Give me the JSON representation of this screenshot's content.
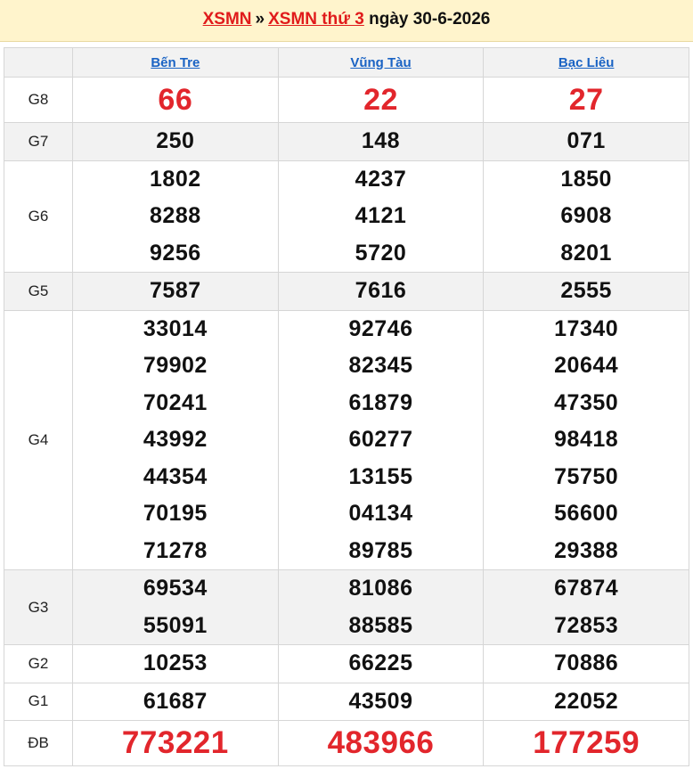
{
  "header": {
    "crumb1": "XSMN",
    "separator": "»",
    "crumb2": "XSMN thứ 3",
    "date_text": "ngày 30-6-2026"
  },
  "provinces": [
    "Bến Tre",
    "Vũng Tàu",
    "Bạc Liêu"
  ],
  "prizes": [
    {
      "label": "G8",
      "key": "g8",
      "shade": false,
      "values": [
        [
          "66"
        ],
        [
          "22"
        ],
        [
          "27"
        ]
      ]
    },
    {
      "label": "G7",
      "key": "g7",
      "shade": true,
      "values": [
        [
          "250"
        ],
        [
          "148"
        ],
        [
          "071"
        ]
      ]
    },
    {
      "label": "G6",
      "key": "g6",
      "shade": false,
      "values": [
        [
          "1802",
          "8288",
          "9256"
        ],
        [
          "4237",
          "4121",
          "5720"
        ],
        [
          "1850",
          "6908",
          "8201"
        ]
      ]
    },
    {
      "label": "G5",
      "key": "g5",
      "shade": true,
      "values": [
        [
          "7587"
        ],
        [
          "7616"
        ],
        [
          "2555"
        ]
      ]
    },
    {
      "label": "G4",
      "key": "g4",
      "shade": false,
      "values": [
        [
          "33014",
          "79902",
          "70241",
          "43992",
          "44354",
          "70195",
          "71278"
        ],
        [
          "92746",
          "82345",
          "61879",
          "60277",
          "13155",
          "04134",
          "89785"
        ],
        [
          "17340",
          "20644",
          "47350",
          "98418",
          "75750",
          "56600",
          "29388"
        ]
      ]
    },
    {
      "label": "G3",
      "key": "g3",
      "shade": true,
      "values": [
        [
          "69534",
          "55091"
        ],
        [
          "81086",
          "88585"
        ],
        [
          "67874",
          "72853"
        ]
      ]
    },
    {
      "label": "G2",
      "key": "g2",
      "shade": false,
      "values": [
        [
          "10253"
        ],
        [
          "66225"
        ],
        [
          "70886"
        ]
      ]
    },
    {
      "label": "G1",
      "key": "g1",
      "shade": false,
      "values": [
        [
          "61687"
        ],
        [
          "43509"
        ],
        [
          "22052"
        ]
      ]
    },
    {
      "label": "ĐB",
      "key": "db",
      "shade": false,
      "values": [
        [
          "773221"
        ],
        [
          "483966"
        ],
        [
          "177259"
        ]
      ]
    }
  ],
  "colors": {
    "accent_red": "#e2262c",
    "link_blue": "#1a63c4",
    "header_bg": "#fff4cc",
    "shade_bg": "#f2f2f2"
  }
}
